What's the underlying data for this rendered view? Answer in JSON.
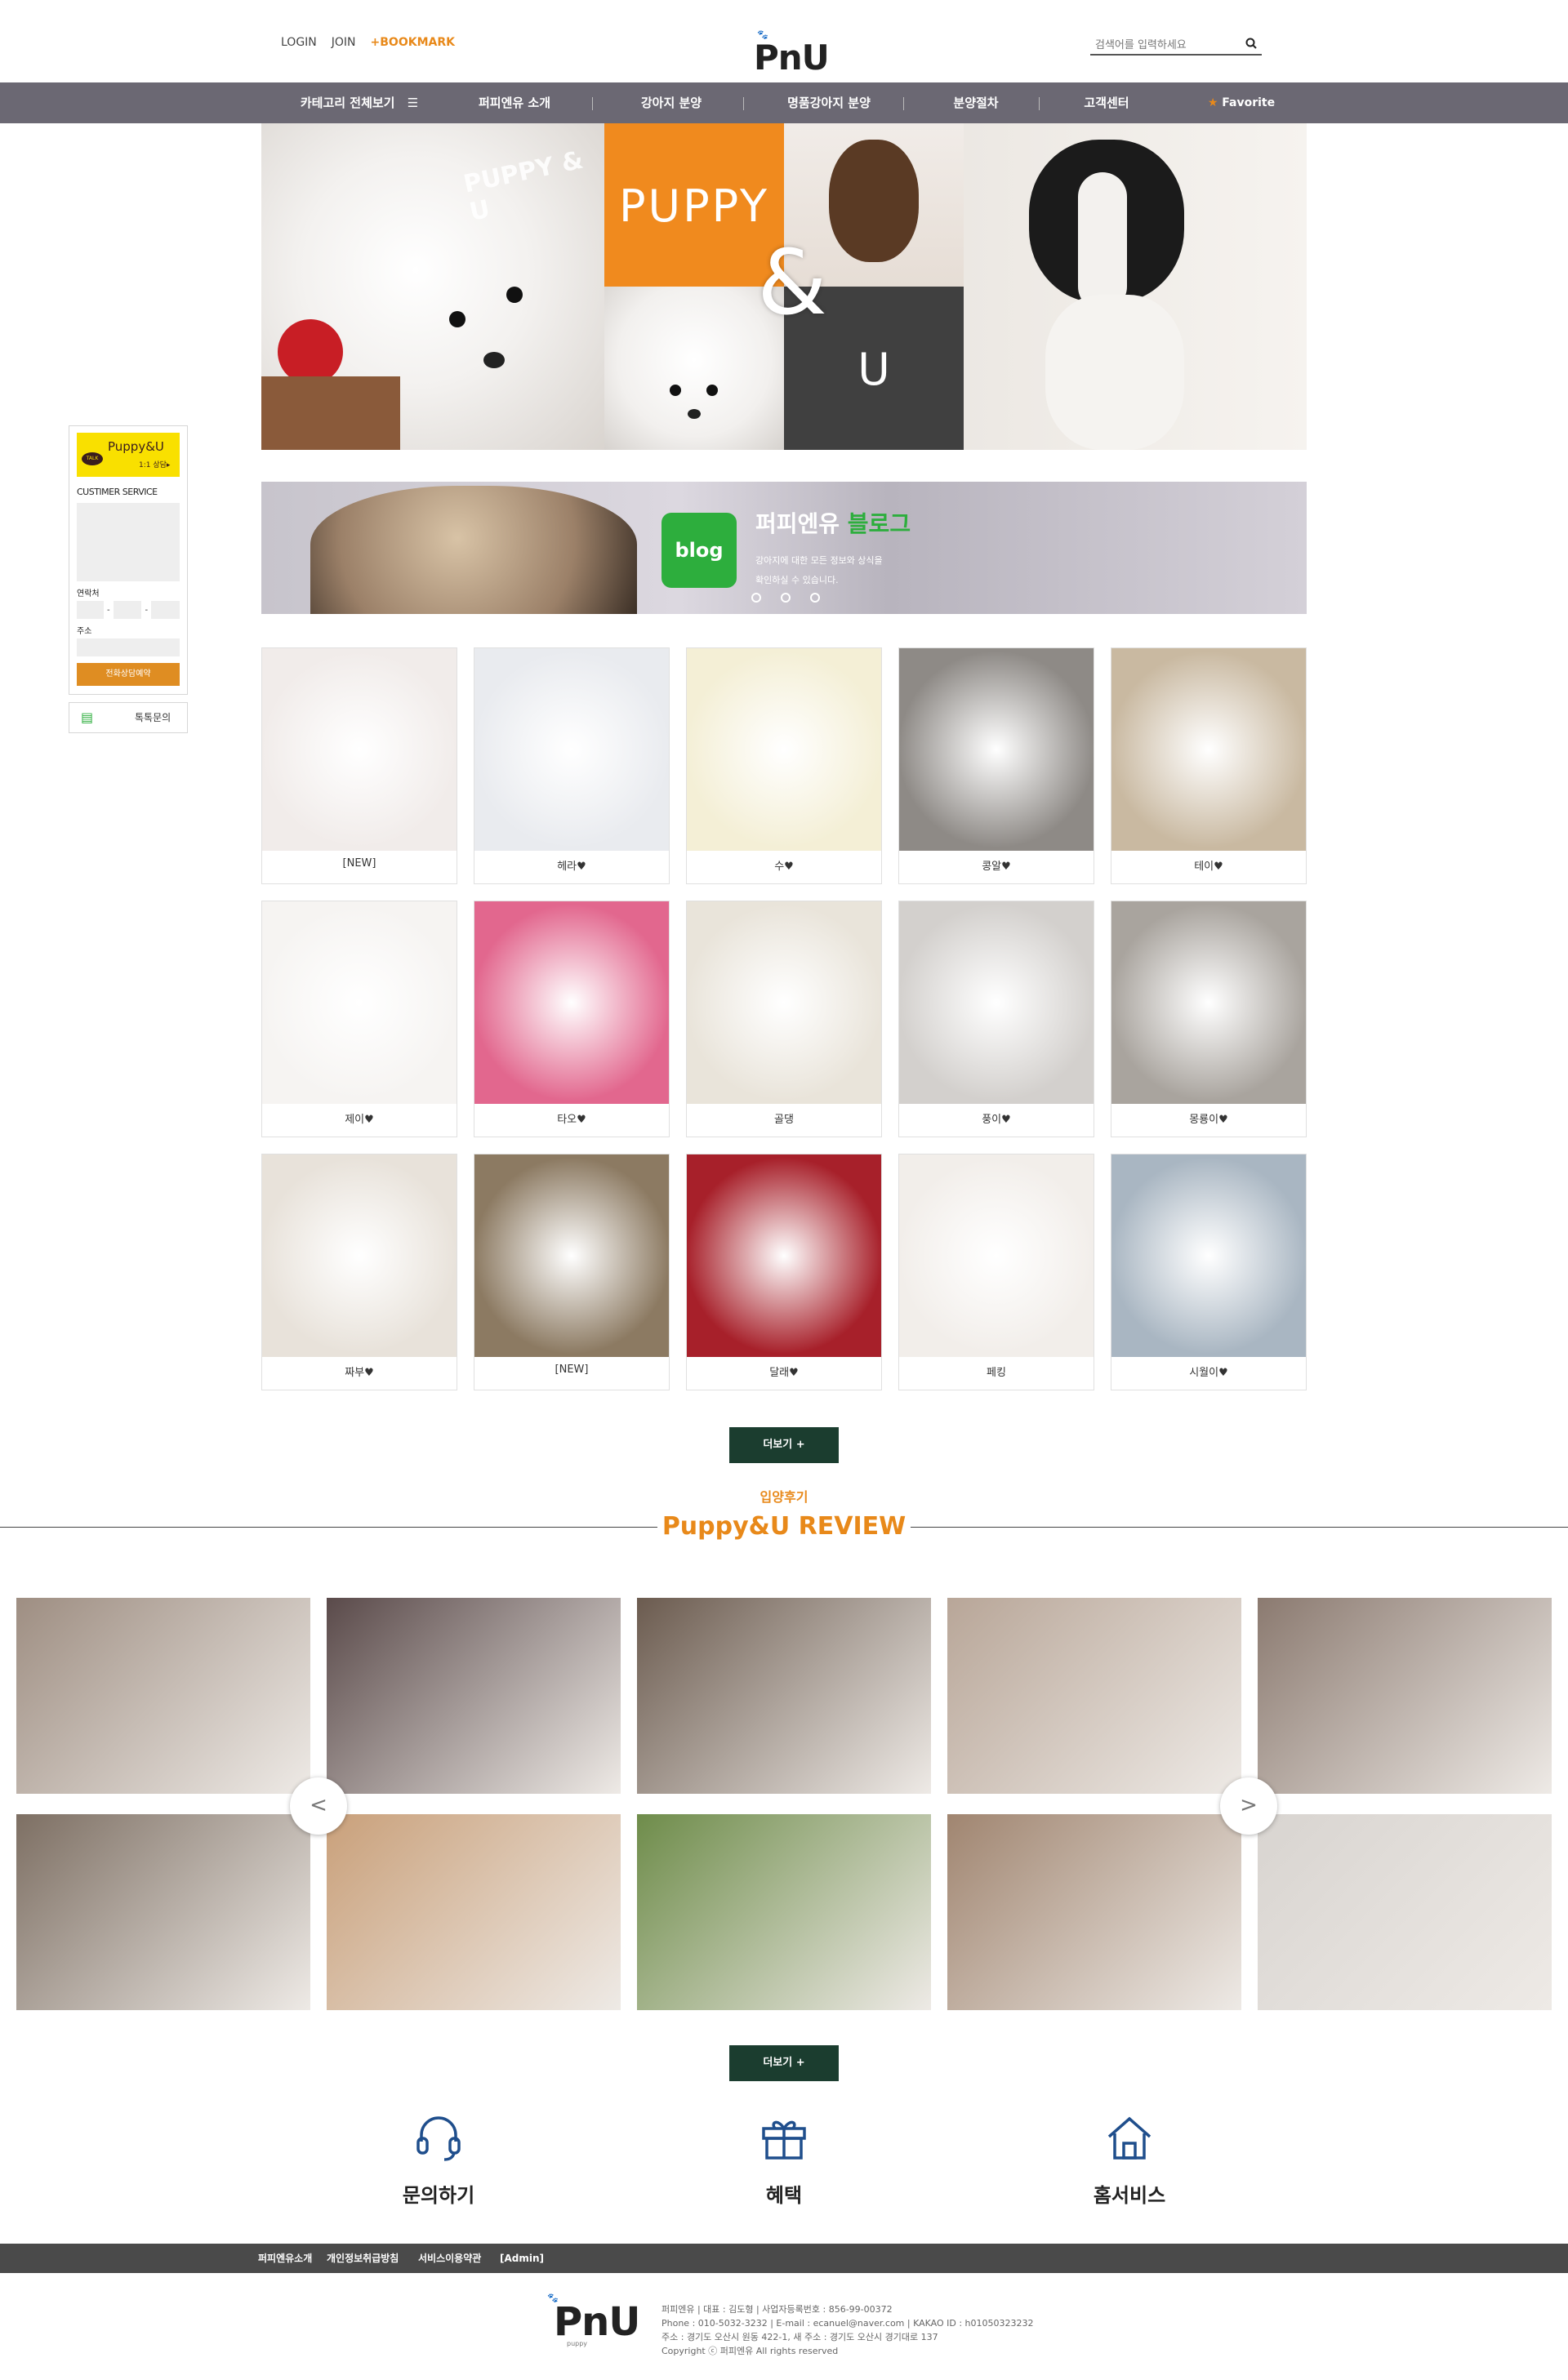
{
  "header": {
    "login": "LOGIN",
    "join": "JOIN",
    "bookmark": "+BOOKMARK",
    "logo_text": "PnU",
    "logo_small": "puppy",
    "search_placeholder": "검색어를 입력하세요"
  },
  "nav": {
    "category_all": "카테고리 전체보기",
    "items": [
      "퍼피엔유 소개",
      "강아지 분양",
      "명품강아지 분양",
      "분양절차",
      "고객센터"
    ],
    "favorite": "Favorite"
  },
  "hero": {
    "puppy": "PUPPY",
    "amp": "&",
    "u": "U",
    "watermark": "PUPPY & U"
  },
  "blog": {
    "badge": "blog",
    "title_a": "퍼피엔유",
    "title_b": "블로그",
    "desc1": "강아지에 대한 모든 정보와 상식을",
    "desc2": "확인하실 수 있습니다."
  },
  "products": [
    {
      "name": "[NEW]",
      "color": "#f1ecea"
    },
    {
      "name": "헤라♥",
      "color": "#e9ebef"
    },
    {
      "name": "수♥",
      "color": "#f4efd6"
    },
    {
      "name": "콩알♥",
      "color": "#8e8a86"
    },
    {
      "name": "테이♥",
      "color": "#c9b9a1"
    },
    {
      "name": "제이♥",
      "color": "#f6f4f2"
    },
    {
      "name": "타오♥",
      "color": "#e2678e"
    },
    {
      "name": "골댕",
      "color": "#e9e4da"
    },
    {
      "name": "풍이♥",
      "color": "#d3d0cd"
    },
    {
      "name": "몽룡이♥",
      "color": "#a9a49e"
    },
    {
      "name": "짜부♥",
      "color": "#e8e2da"
    },
    {
      "name": "[NEW]",
      "color": "#8c7a62"
    },
    {
      "name": "달래♥",
      "color": "#a7202a"
    },
    {
      "name": "페킹",
      "color": "#f2eeea"
    },
    {
      "name": "시월이♥",
      "color": "#a9b6c2"
    }
  ],
  "more_label": "더보기 +",
  "review": {
    "subtitle": "입양후기",
    "title": "Puppy&U REVIEW",
    "prev": "<",
    "next": ">",
    "colors": [
      "#9e8e82",
      "#5a4a4a",
      "#6b5b4f",
      "#b8a698",
      "#8b7a70",
      "#7d6f63",
      "#c9a07a",
      "#6e8c4a",
      "#a08570",
      "#d8d4d0"
    ]
  },
  "services": {
    "inquiry": "문의하기",
    "benefit": "혜택",
    "homeservice": "홈서비스"
  },
  "footer": {
    "links": [
      "퍼피엔유소개",
      "개인정보취급방침",
      "서비스이용약관",
      "[Admin]"
    ],
    "line1": "퍼피엔유 | 대표 : 김도형 | 사업자등록번호 : 856-99-00372",
    "line2": "Phone : 010-5032-3232 | E-mail : ecanuel@naver.com | KAKAO ID : h01050323232",
    "line3": "주소 : 경기도 오산시 원동 422-1, 새 주소 : 경기도 오산시 경기대로 137",
    "line4": "Copyright ⓒ 퍼피엔유 All rights reserved"
  },
  "sidebar": {
    "brand": "Puppy&U",
    "sub": "1:1 상담▸",
    "talk": "TALK",
    "service": "CUSTIMER SERVICE",
    "contact": "연락처",
    "address": "주소",
    "dash": "-",
    "reserve": "전화상담예약",
    "talk_inquiry": "톡톡문의"
  }
}
